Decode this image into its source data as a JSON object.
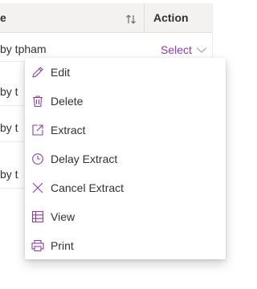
{
  "table": {
    "header": {
      "name_col": "e",
      "action_col": "Action"
    },
    "rows": [
      {
        "text": "by tpham",
        "action": "Select"
      },
      {
        "text": "by t"
      },
      {
        "text": "by t"
      },
      {
        "text": "by t"
      }
    ]
  },
  "context_menu": {
    "items": [
      {
        "label": "Edit",
        "icon": "pencil-icon"
      },
      {
        "label": "Delete",
        "icon": "trash-icon"
      },
      {
        "label": "Extract",
        "icon": "open-external-icon"
      },
      {
        "label": "Delay Extract",
        "icon": "clock-icon"
      },
      {
        "label": "Cancel Extract",
        "icon": "x-icon"
      },
      {
        "label": "View",
        "icon": "table-icon"
      },
      {
        "label": "Print",
        "icon": "printer-icon"
      }
    ]
  },
  "colors": {
    "accent": "#8a3da8",
    "header_bg": "#f3f2f1",
    "text": "#323130"
  }
}
